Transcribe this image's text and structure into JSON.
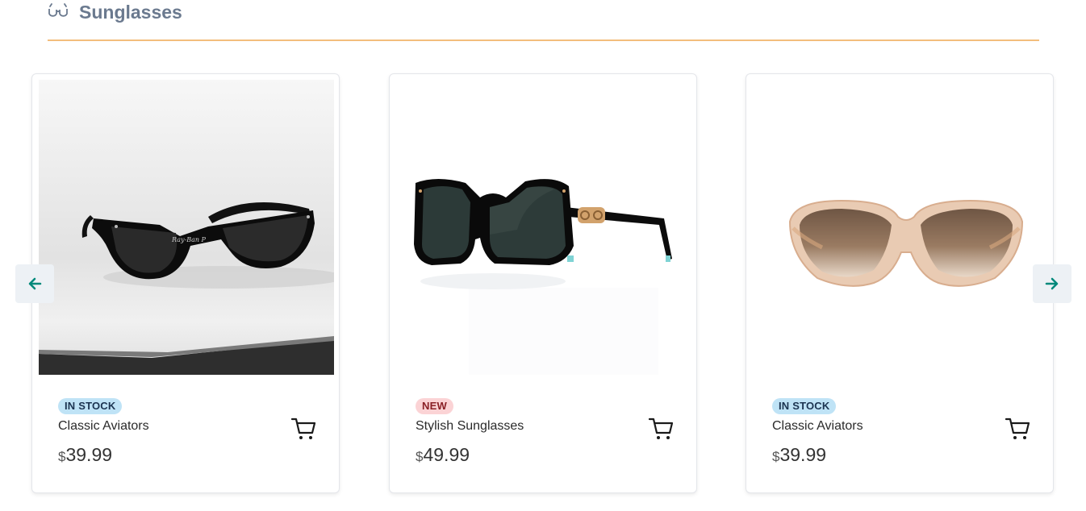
{
  "section": {
    "title": "Sunglasses",
    "icon": "glasses-icon",
    "accent_color": "#f3be7c"
  },
  "carousel": {
    "prev_icon": "arrow-left-icon",
    "next_icon": "arrow-right-icon",
    "arrow_color": "#00897b"
  },
  "products": [
    {
      "status": "IN STOCK",
      "name": "Classic Aviators",
      "currency": "$",
      "price": "39.99",
      "image": "black-wayfarer-sunglasses-photo"
    },
    {
      "status": "NEW",
      "name": "Stylish Sunglasses",
      "currency": "$",
      "price": "49.99",
      "image": "black-square-sunglasses-photo"
    },
    {
      "status": "IN STOCK",
      "name": "Classic Aviators",
      "currency": "$",
      "price": "39.99",
      "image": "rose-oversized-sunglasses-photo"
    }
  ]
}
